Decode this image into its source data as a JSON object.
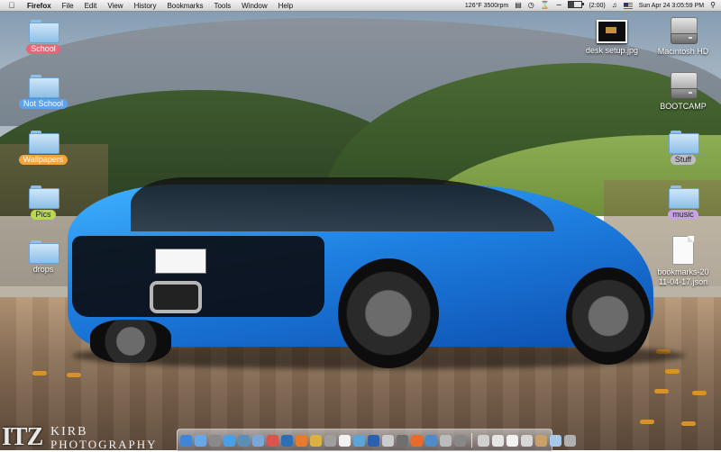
{
  "menubar": {
    "app_name": "Firefox",
    "items": [
      "File",
      "Edit",
      "View",
      "History",
      "Bookmarks",
      "Tools",
      "Window",
      "Help"
    ],
    "status": {
      "temperature": "126°F 3500rpm",
      "battery_text": "(2:00)",
      "battery_level": 0.4,
      "clock": "Sun Apr 24  3:05:59 PM"
    }
  },
  "desktop": {
    "left_column": [
      {
        "label": "School",
        "color": "#e8657a"
      },
      {
        "label": "Not School",
        "color": "#5ea3ea"
      },
      {
        "label": "Wallpapers",
        "color": "#f2a33c"
      },
      {
        "label": "Pics",
        "color": "#b8d94a"
      },
      {
        "label": "drops",
        "color": ""
      }
    ],
    "right_items": {
      "desk_setup": "desk setup.jpg",
      "macintosh_hd": "Macintosh HD",
      "bootcamp": "BOOTCAMP",
      "stuff": "Stuff",
      "music": "music",
      "bookmarks_line1": "bookmarks-20",
      "bookmarks_line2": "11-04-17.json"
    }
  },
  "watermark": {
    "prefix": "ITZ",
    "line1": "KIRB",
    "line2": "PHOTOGRAPHY"
  },
  "dock": {
    "apps": [
      {
        "name": "finder",
        "color": "#3f86d9"
      },
      {
        "name": "app-store",
        "color": "#6aa7e8"
      },
      {
        "name": "system-preferences",
        "color": "#8a8a8a"
      },
      {
        "name": "safari",
        "color": "#4aa0e6"
      },
      {
        "name": "spotlight-app",
        "color": "#5c8fb8"
      },
      {
        "name": "mail",
        "color": "#7aa7d6"
      },
      {
        "name": "ical",
        "color": "#d9534f"
      },
      {
        "name": "photoshop",
        "color": "#2d6fb5"
      },
      {
        "name": "firefox",
        "color": "#e87b2b"
      },
      {
        "name": "app-10",
        "color": "#d9b23f"
      },
      {
        "name": "app-11",
        "color": "#9e9e9e"
      },
      {
        "name": "calendar",
        "color": "#f1f1f1"
      },
      {
        "name": "itunes",
        "color": "#5fa4d9"
      },
      {
        "name": "word",
        "color": "#2b5fb0"
      },
      {
        "name": "keynote",
        "color": "#cccccc"
      },
      {
        "name": "app-16",
        "color": "#6f6f6f"
      },
      {
        "name": "app-17",
        "color": "#e86b2b"
      },
      {
        "name": "app-18",
        "color": "#4f8bc9"
      },
      {
        "name": "app-19",
        "color": "#bbbbbb"
      },
      {
        "name": "app-20",
        "color": "#888888"
      }
    ],
    "stacks": [
      {
        "name": "globe",
        "color": "#d0d0d0"
      },
      {
        "name": "doc-1",
        "color": "#e5e5e5"
      },
      {
        "name": "doc-2",
        "color": "#f2f2f2"
      },
      {
        "name": "doc-3",
        "color": "#d7d7d7"
      },
      {
        "name": "image-stack",
        "color": "#c9a06a"
      },
      {
        "name": "folder-stack",
        "color": "#a8c8e8"
      },
      {
        "name": "trash",
        "color": "#b0b0b0"
      }
    ]
  }
}
